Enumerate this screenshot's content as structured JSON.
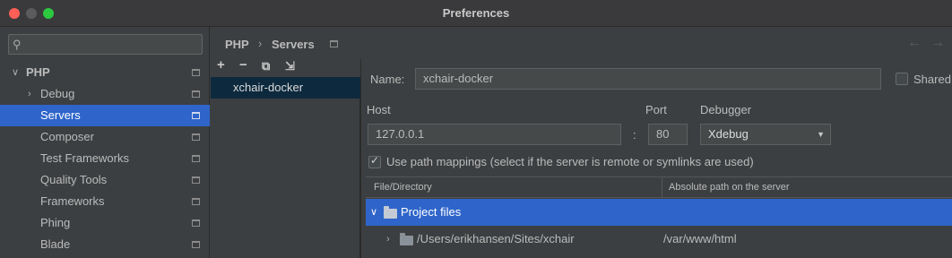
{
  "window": {
    "title": "Preferences"
  },
  "sidebar": {
    "search_placeholder": "",
    "items": [
      {
        "label": "PHP",
        "expanded": true
      },
      {
        "label": "Debug"
      },
      {
        "label": "Servers",
        "selected": true
      },
      {
        "label": "Composer"
      },
      {
        "label": "Test Frameworks"
      },
      {
        "label": "Quality Tools"
      },
      {
        "label": "Frameworks"
      },
      {
        "label": "Phing"
      },
      {
        "label": "Blade"
      }
    ]
  },
  "breadcrumb": {
    "parent": "PHP",
    "separator": "›",
    "current": "Servers"
  },
  "nav": {
    "back": "←",
    "forward": "→"
  },
  "toolbar": {
    "add": "+",
    "remove": "−",
    "copy": "⧉",
    "import": "⇲"
  },
  "servers": [
    {
      "label": "xchair-docker",
      "selected": true
    }
  ],
  "form": {
    "name_label": "Name:",
    "name_value": "xchair-docker",
    "shared_label": "Shared",
    "shared_checked": false,
    "host_label": "Host",
    "host_value": "127.0.0.1",
    "colon": ":",
    "port_label": "Port",
    "port_value": "80",
    "debugger_label": "Debugger",
    "debugger_value": "Xdebug",
    "use_path_mappings_label": "Use path mappings (select if the server is remote or symlinks are used)",
    "use_path_mappings_checked": true
  },
  "table": {
    "columns": [
      "File/Directory",
      "Absolute path on the server"
    ],
    "rows": [
      {
        "file": "Project files",
        "server_path": "",
        "expanded": true,
        "selected": true
      },
      {
        "file": "/Users/erikhansen/Sites/xchair",
        "server_path": "/var/www/html",
        "expanded": false,
        "selected": false
      }
    ]
  },
  "colors": {
    "accent": "#2f65ca",
    "background": "#3c3f41",
    "field": "#45494a",
    "list_selection": "#0d293e"
  }
}
